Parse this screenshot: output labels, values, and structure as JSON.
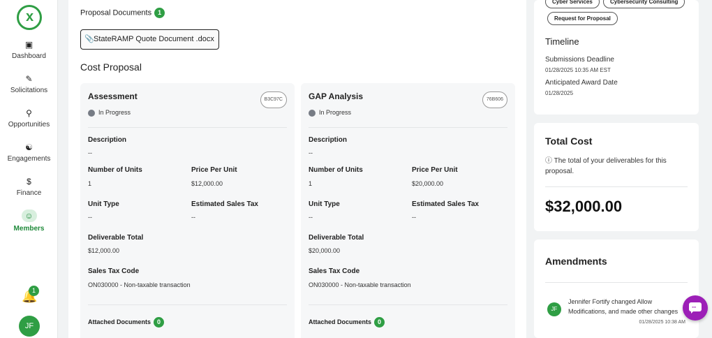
{
  "sidebar": {
    "logo_text": "x",
    "items": [
      {
        "label": "Dashboard",
        "icon": "dashboard-icon"
      },
      {
        "label": "Solicitations",
        "icon": "solicitations-icon"
      },
      {
        "label": "Opportunities",
        "icon": "search-icon"
      },
      {
        "label": "Engagements",
        "icon": "handshake-icon"
      },
      {
        "label": "Finance",
        "icon": "dollar-icon"
      },
      {
        "label": "Members",
        "icon": "members-icon",
        "active": true
      }
    ],
    "notification_count": "1",
    "avatar_initials": "JF"
  },
  "main": {
    "proposal_documents_label": "Proposal Documents",
    "proposal_documents_count": "1",
    "document_name": "StateRAMP Quote Document .docx",
    "cost_proposal_title": "Cost Proposal",
    "cards": [
      {
        "title": "Assessment",
        "id": "B3C97C",
        "status": "In Progress",
        "description_label": "Description",
        "description": "--",
        "units_label": "Number of Units",
        "units": "1",
        "price_label": "Price Per Unit",
        "price": "$12,000.00",
        "unit_type_label": "Unit Type",
        "unit_type": "--",
        "est_tax_label": "Estimated Sales Tax",
        "est_tax": "--",
        "total_label": "Deliverable Total",
        "total": "$12,000.00",
        "tax_code_label": "Sales Tax Code",
        "tax_code": "ON030000 - Non-taxable transaction",
        "attached_label": "Attached Documents",
        "attached_count": "0"
      },
      {
        "title": "GAP Analysis",
        "id": "76B606",
        "status": "In Progress",
        "description_label": "Description",
        "description": "--",
        "units_label": "Number of Units",
        "units": "1",
        "price_label": "Price Per Unit",
        "price": "$20,000.00",
        "unit_type_label": "Unit Type",
        "unit_type": "--",
        "est_tax_label": "Estimated Sales Tax",
        "est_tax": "--",
        "total_label": "Deliverable Total",
        "total": "$20,000.00",
        "tax_code_label": "Sales Tax Code",
        "tax_code": "ON030000 - Non-taxable transaction",
        "attached_label": "Attached Documents",
        "attached_count": "0"
      }
    ]
  },
  "right": {
    "tags": [
      "Cyber Services",
      "Cybersecurity Consulting",
      "Request for Proposal"
    ],
    "timeline_title": "Timeline",
    "submission_label": "Submissions Deadline",
    "submission_value": "01/28/2025 10:35 AM EST",
    "award_label": "Anticipated Award Date",
    "award_value": "01/28/2025",
    "total_title": "Total Cost",
    "total_desc": "The total of your deliverables for this proposal.",
    "total_value": "$32,000.00",
    "amendments_title": "Amendments",
    "amendment": {
      "initials": "JF",
      "text": "Jennifer Fortify changed Allow Modifications, and made other changes",
      "time": "01/28/2025 10:38 AM"
    }
  },
  "colors": {
    "accent": "#2f9e44",
    "chat": "#9c1fb7",
    "status_dot": "#777c85"
  }
}
